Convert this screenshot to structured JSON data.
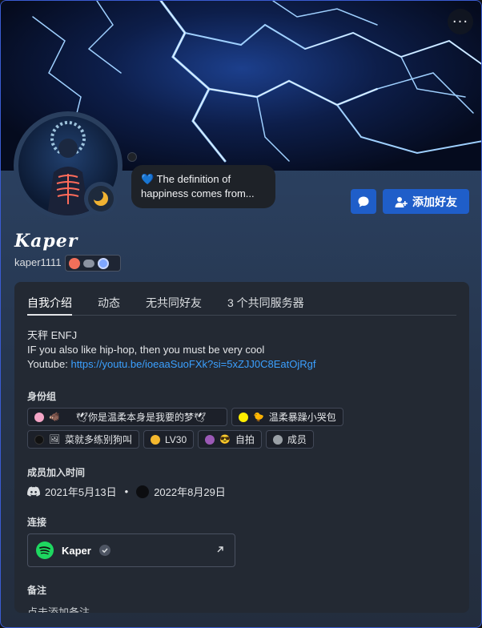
{
  "banner": {
    "more_label": "···"
  },
  "status_bubble": {
    "heart": "💙",
    "text": "The definition of happiness comes from..."
  },
  "actions": {
    "message_icon": "chat-bubble-icon",
    "add_friend_label": "添加好友"
  },
  "profile": {
    "display_name": "Kaper",
    "username": "kaper1111"
  },
  "tabs": [
    "自我介绍",
    "动态",
    "无共同好友",
    "3 个共同服务器"
  ],
  "about": {
    "line1": "天秤  ENFJ",
    "line2": "IF you also like hip-hop, then you must be very cool",
    "youtube_label": "Youtube: ",
    "youtube_link": "https://youtu.be/ioeaaSuoFXk?si=5xZJJ0C8EatOjRgf"
  },
  "roles_title": "身份组",
  "roles": [
    {
      "color": "#f4a5c6",
      "emoji": "🐗",
      "label": "🕊你是温柔本身是我要的梦🕊"
    },
    {
      "color": "#ffee00",
      "emoji": "🐤",
      "label": "温柔暴躁小哭包"
    },
    {
      "color": "#111111",
      "emoji": "🖼",
      "label": "菜就多练别狗叫"
    },
    {
      "color": "#f5b82e",
      "emoji": "",
      "label": "LV30"
    },
    {
      "color": "#9b59b6",
      "emoji": "😎",
      "label": "自拍"
    },
    {
      "color": "#9aa0a6",
      "emoji": "",
      "label": "成员"
    }
  ],
  "member_since_title": "成员加入时间",
  "member_since": {
    "discord_date": "2021年5月13日",
    "separator": "•",
    "server_date": "2022年8月29日"
  },
  "connections_title": "连接",
  "connection": {
    "service_icon": "spotify-icon",
    "name": "Kaper",
    "verified_icon": "check-icon",
    "external_icon": "arrow-up-right-icon"
  },
  "note_title": "备注",
  "note_placeholder": "点击添加备注",
  "colors": {
    "accent": "#1f5ec9",
    "link": "#3ba0ff",
    "spotify": "#1ed760"
  }
}
